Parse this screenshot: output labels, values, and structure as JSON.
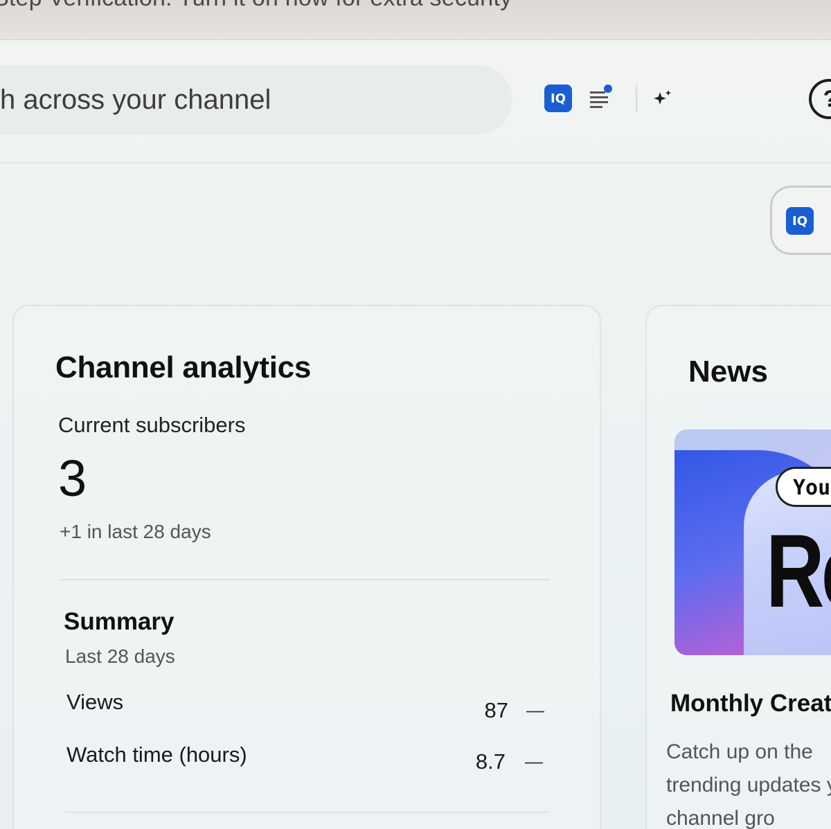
{
  "banner": {
    "text": "Step Verification: Turn it on now for extra security"
  },
  "header": {
    "search_placeholder": "h across your channel",
    "iq_icon_label": "IQ"
  },
  "channel_analytics": {
    "title": "Channel analytics",
    "subscribers_label": "Current subscribers",
    "subscribers_count": "3",
    "subscribers_change": "+1 in last 28 days",
    "summary": {
      "title": "Summary",
      "period": "Last 28 days",
      "metrics": [
        {
          "label": "Views",
          "value": "87",
          "trend": "—"
        },
        {
          "label": "Watch time (hours)",
          "value": "8.7",
          "trend": "—"
        }
      ]
    }
  },
  "news": {
    "title": "News",
    "image_tag": "You",
    "image_text": "Re",
    "article_title": "Monthly Creat",
    "description": "Catch up on the trending updates your channel gro"
  },
  "colors": {
    "accent_blue": "#1a5fd1",
    "gradient_blue": "#2f56e6",
    "gradient_pink": "#e36ac6"
  },
  "icons": [
    "iq-icon",
    "list-notification-icon",
    "sparkle-icon",
    "help-icon"
  ]
}
